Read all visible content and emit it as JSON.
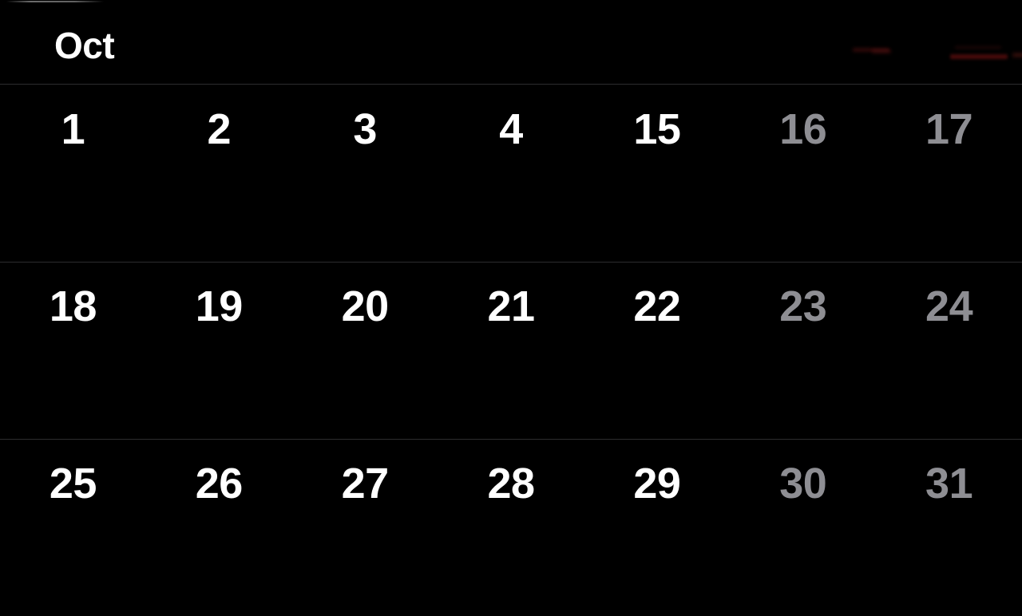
{
  "app": {
    "name": "Calendar",
    "view": "month",
    "theme": "dark",
    "background_color": "#000000",
    "separator_color": "#2c2c2e"
  },
  "header": {
    "month_label": "Oct",
    "title_color": "#ffffff"
  },
  "colors": {
    "weekday_text": "#ffffff",
    "weekend_text": "#8e8e93",
    "background": "#000000",
    "separator": "#2c2c2e",
    "artifact_red": "#a81818"
  },
  "calendar": {
    "columns": 7,
    "weeks": [
      {
        "days": [
          {
            "label": "1",
            "style": "weekday"
          },
          {
            "label": "2",
            "style": "weekday"
          },
          {
            "label": "3",
            "style": "weekday"
          },
          {
            "label": "4",
            "style": "weekday"
          },
          {
            "label": "15",
            "style": "weekday"
          },
          {
            "label": "16",
            "style": "weekend"
          },
          {
            "label": "17",
            "style": "weekend"
          }
        ]
      },
      {
        "days": [
          {
            "label": "18",
            "style": "weekday"
          },
          {
            "label": "19",
            "style": "weekday"
          },
          {
            "label": "20",
            "style": "weekday"
          },
          {
            "label": "21",
            "style": "weekday"
          },
          {
            "label": "22",
            "style": "weekday"
          },
          {
            "label": "23",
            "style": "weekend"
          },
          {
            "label": "24",
            "style": "weekend"
          }
        ]
      },
      {
        "days": [
          {
            "label": "25",
            "style": "weekday"
          },
          {
            "label": "26",
            "style": "weekday"
          },
          {
            "label": "27",
            "style": "weekday"
          },
          {
            "label": "28",
            "style": "weekday"
          },
          {
            "label": "29",
            "style": "weekday"
          },
          {
            "label": "30",
            "style": "weekend"
          },
          {
            "label": "31",
            "style": "weekend"
          }
        ]
      }
    ]
  }
}
